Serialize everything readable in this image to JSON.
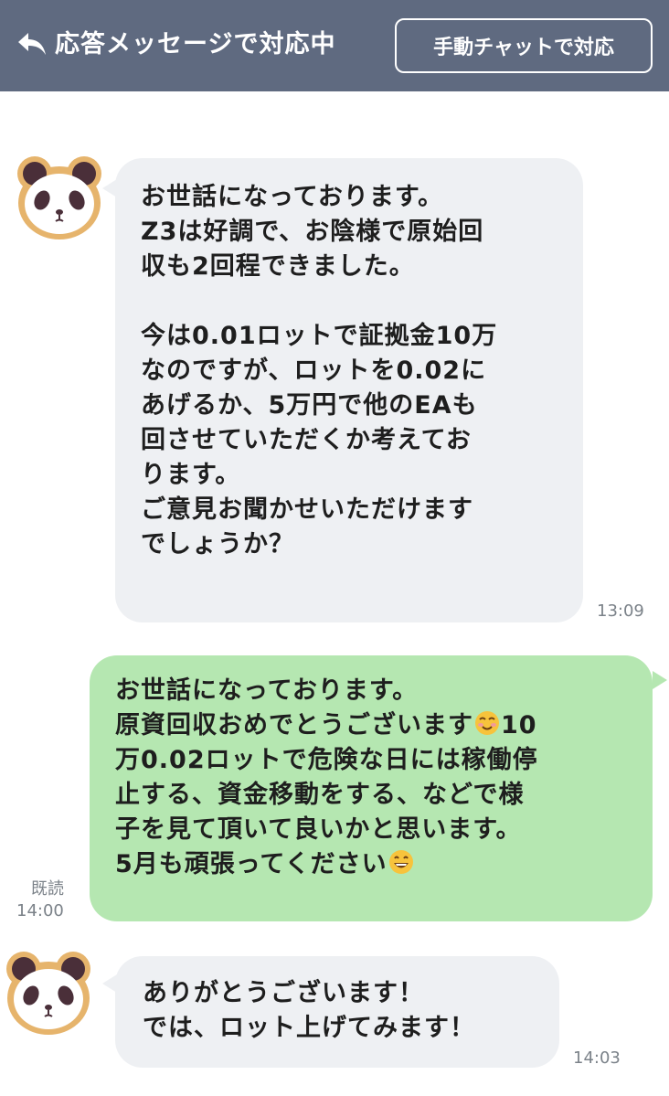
{
  "header": {
    "back_icon": "reply-arrow-icon",
    "title": "応答メッセージで対応中",
    "manual_chat_button": "手動チャットで対応",
    "background": "#5f6a80"
  },
  "messages": [
    {
      "sender": "received",
      "avatar_icon": "panda-avatar-icon",
      "lines": [
        "お世話になっております。",
        "Z3は好調で、お陰様で原始回",
        "収も2回程できました。",
        "",
        "今は0.01ロットで証拠金10万",
        "なのですが、ロットを0.02に",
        "あげるか、5万円で他のEAも",
        "回させていただくか考えてお",
        "ります。",
        "ご意見お聞かせいただけます",
        "でしょうか？"
      ],
      "time": "13:09"
    },
    {
      "sender": "sent",
      "lines": [
        "お世話になっております。",
        "原資回収おめでとうございます",
        "万0.02ロットで危険な日には稼働停",
        "止する、資金移動をする、などで様",
        "子を見て頂いて良いかと思います。",
        "5月も頑張ってください"
      ],
      "line2_suffix": "10",
      "emoji_1": "smiling-face-emoji",
      "emoji_2": "grinning-face-emoji",
      "read_label": "既読",
      "time": "14:00"
    },
    {
      "sender": "received",
      "avatar_icon": "panda-avatar-icon",
      "lines": [
        "ありがとうございます！",
        "では、ロット上げてみます！"
      ],
      "time": "14:03"
    }
  ],
  "colors": {
    "received_bubble": "#eef0f3",
    "sent_bubble": "#b5e7b1",
    "timestamp": "#7b8289"
  }
}
